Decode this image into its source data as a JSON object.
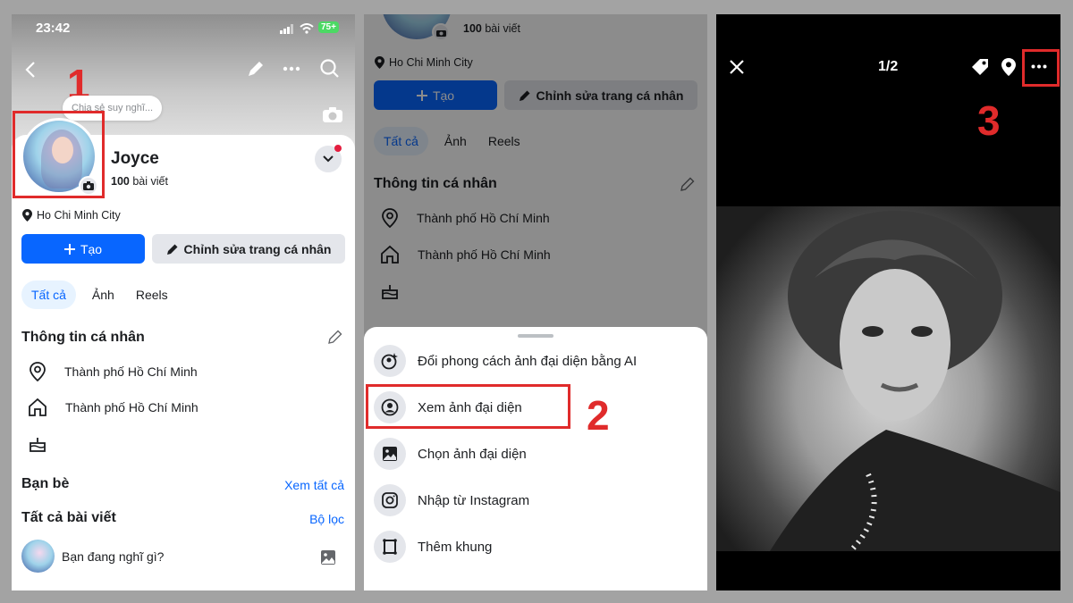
{
  "panel1": {
    "status_time": "23:42",
    "battery": "75+",
    "thought": "Chia sẻ suy nghĩ...",
    "name": "Joyce",
    "posts_count": "100",
    "posts_label": "bài viết",
    "location": "Ho Chi Minh City",
    "create_label": "Tạo",
    "edit_label": "Chỉnh sửa trang cá nhân",
    "tabs": [
      "Tất cả",
      "Ảnh",
      "Reels"
    ],
    "info_title": "Thông tin cá nhân",
    "info_items": [
      "Thành phố Hồ Chí Minh",
      "Thành phố Hồ Chí Minh"
    ],
    "friends_title": "Bạn bè",
    "see_all": "Xem tất cả",
    "posts_title": "Tất cả bài viết",
    "filter": "Bộ lọc",
    "composer_placeholder": "Bạn đang nghĩ gì?",
    "step": "1"
  },
  "panel2": {
    "posts_count": "100",
    "posts_label": "bài viết",
    "location": "Ho Chi Minh City",
    "create_label": "Tạo",
    "edit_label": "Chỉnh sửa trang cá nhân",
    "tabs": [
      "Tất cả",
      "Ảnh",
      "Reels"
    ],
    "info_title": "Thông tin cá nhân",
    "info_items": [
      "Thành phố Hồ Chí Minh",
      "Thành phố Hồ Chí Minh"
    ],
    "menu": [
      "Đổi phong cách ảnh đại diện bằng AI",
      "Xem ảnh đại diện",
      "Chọn ảnh đại diện",
      "Nhập từ Instagram",
      "Thêm khung"
    ],
    "step": "2"
  },
  "panel3": {
    "counter": "1/2",
    "step": "3"
  },
  "colors": {
    "accent": "#0866ff",
    "highlight": "#e02b2b"
  }
}
